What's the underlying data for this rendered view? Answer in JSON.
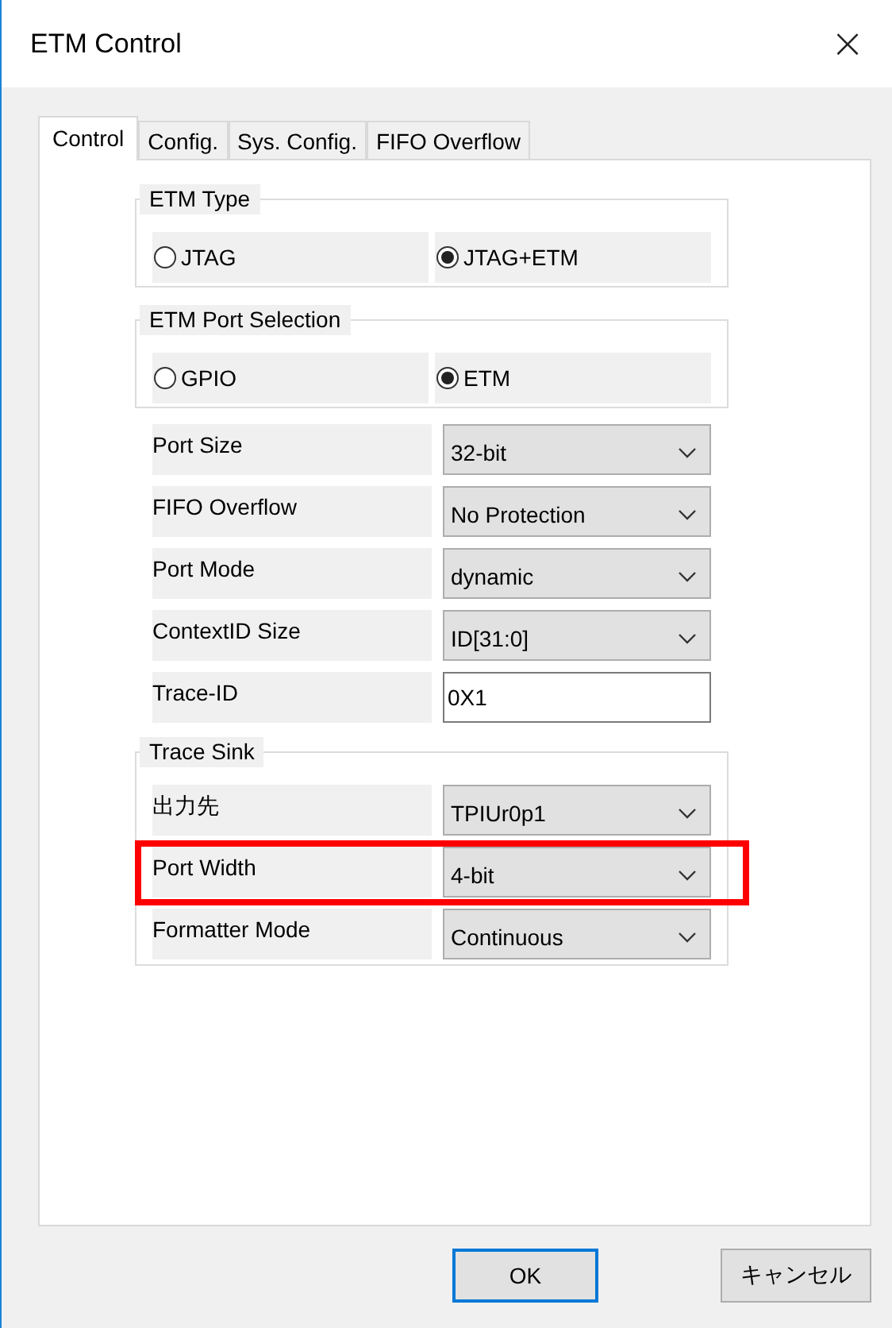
{
  "window": {
    "title": "ETM Control",
    "close": "×"
  },
  "tabs": [
    {
      "label": "Control",
      "selected": true
    },
    {
      "label": "Config.",
      "selected": false
    },
    {
      "label": "Sys. Config.",
      "selected": false
    },
    {
      "label": "FIFO Overflow",
      "selected": false
    }
  ],
  "etm_type": {
    "title": "ETM Type",
    "options": [
      {
        "label": "JTAG",
        "selected": false
      },
      {
        "label": "JTAG+ETM",
        "selected": true
      }
    ]
  },
  "etm_port_selection": {
    "title": "ETM Port Selection",
    "options": [
      {
        "label": "GPIO",
        "selected": false
      },
      {
        "label": "ETM",
        "selected": true
      }
    ]
  },
  "fields": [
    {
      "label": "Port Size",
      "kind": "select",
      "value": "32-bit"
    },
    {
      "label": "FIFO Overflow",
      "kind": "select",
      "value": "No Protection"
    },
    {
      "label": "Port Mode",
      "kind": "select",
      "value": "dynamic"
    },
    {
      "label": "ContextID Size",
      "kind": "select",
      "value": "ID[31:0]"
    },
    {
      "label": "Trace-ID",
      "kind": "text",
      "value": "0X1"
    }
  ],
  "trace_sink": {
    "title": "Trace Sink",
    "fields": [
      {
        "label": "出力先",
        "kind": "select",
        "value": "TPIUr0p1",
        "highlighted": false
      },
      {
        "label": "Port Width",
        "kind": "select",
        "value": "4-bit",
        "highlighted": true
      },
      {
        "label": "Formatter Mode",
        "kind": "select",
        "value": "Continuous",
        "highlighted": false
      }
    ]
  },
  "buttons": [
    {
      "label": "OK",
      "default": true
    },
    {
      "label": "キャンセル",
      "default": false
    }
  ]
}
